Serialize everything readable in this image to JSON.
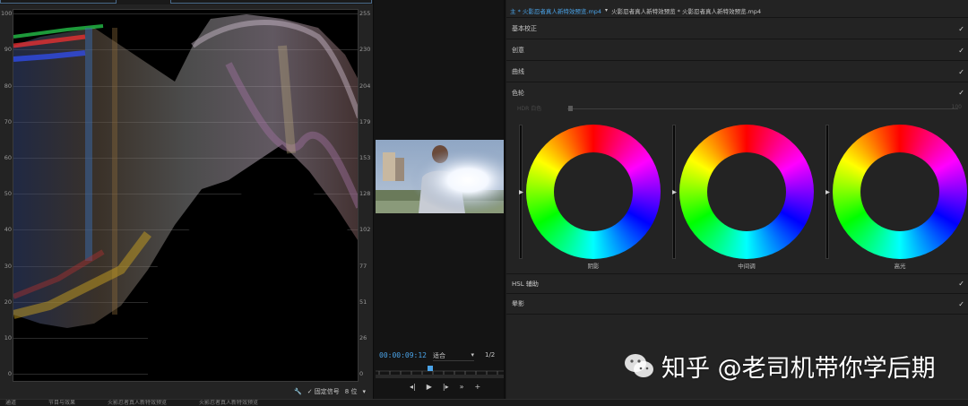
{
  "scope": {
    "left_ticks": [
      "100",
      "90",
      "80",
      "70",
      "60",
      "50",
      "40",
      "30",
      "20",
      "10",
      "0"
    ],
    "right_ticks": [
      "255",
      "230",
      "204",
      "179",
      "153",
      "128",
      "102",
      "77",
      "51",
      "26",
      "0"
    ],
    "toolbar": {
      "clamp_label": "✓ 固定信号",
      "bit_depth": "8 位"
    }
  },
  "bottom_tabs": [
    "通道",
    "节目与效果",
    "火影忍者真人新特效预览",
    "火影忍者真人新特效预览"
  ],
  "monitor": {
    "timecode": "00:00:09:12",
    "fit": "适合",
    "fraction": "1/2"
  },
  "lumetri": {
    "header_main": "主 * 火影忍者真人新特效预览.mp4",
    "header_seq": "火影忍者真人新特效预览 * 火影忍者真人新特效预览.mp4",
    "sections": [
      {
        "label": "基本校正",
        "checked": "✓"
      },
      {
        "label": "创意",
        "checked": "✓"
      },
      {
        "label": "曲线",
        "checked": "✓"
      },
      {
        "label": "色轮",
        "checked": "✓"
      }
    ],
    "hdr_label": "HDR 白色",
    "hdr_value": "100",
    "wheels": [
      {
        "label": "阴影"
      },
      {
        "label": "中间调"
      },
      {
        "label": "高光"
      }
    ],
    "lower_sections": [
      {
        "label": "HSL 辅助",
        "checked": "✓"
      },
      {
        "label": "晕影",
        "checked": "✓"
      }
    ]
  },
  "watermark": {
    "text": "知乎 @老司机带你学后期"
  }
}
